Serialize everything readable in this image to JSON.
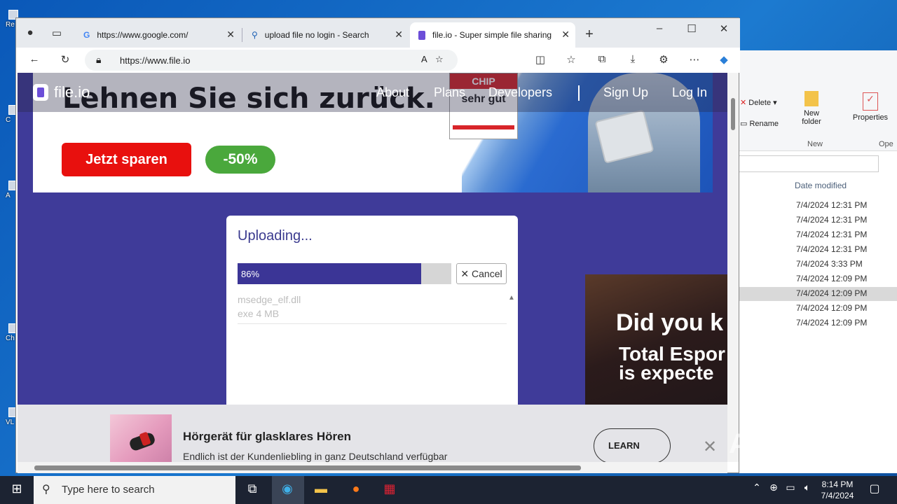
{
  "desktop": {
    "icons": [
      "Re",
      "C",
      "A",
      "Ch",
      "VL"
    ]
  },
  "explorer": {
    "ribbon": {
      "delete": "Delete",
      "rename": "Rename",
      "new_folder": "New folder",
      "new_group": "New",
      "properties": "Properties",
      "open": "Ope"
    },
    "column": "Date modified",
    "dates": [
      "7/4/2024 12:31 PM",
      "7/4/2024 12:31 PM",
      "7/4/2024 12:31 PM",
      "7/4/2024 12:31 PM",
      "7/4/2024 3:33 PM",
      "7/4/2024 12:09 PM",
      "7/4/2024 12:09 PM",
      "7/4/2024 12:09 PM",
      "7/4/2024 12:09 PM"
    ]
  },
  "browser": {
    "tabs": [
      {
        "label": "https://www.google.com/"
      },
      {
        "label": "upload file no login - Search"
      },
      {
        "label": "file.io - Super simple file sharing"
      }
    ],
    "url": "https://www.file.io"
  },
  "site": {
    "logo": "file.io",
    "nav": [
      "About",
      "Plans",
      "Developers",
      "Sign Up",
      "Log In"
    ]
  },
  "ad_top": {
    "headline": "Lehnen Sie sich zurück.",
    "button": "Jetzt sparen",
    "badge": "-50%",
    "chip_title": "sehr gut",
    "chip_brand": "CHIP"
  },
  "upload": {
    "title": "Uploading...",
    "percent": "86%",
    "progress": 0.86,
    "cancel": "Cancel",
    "file_name": "msedge_elf.dll",
    "file_size": "exe 4 MB"
  },
  "ad_right": {
    "line1": "Did you k",
    "line2": "Total Espor",
    "line3": "is expecte"
  },
  "ad_bottom": {
    "title": "Hörgerät für glasklares Hören",
    "subtitle": "Endlich ist der Kundenliebling in ganz Deutschland verfügbar",
    "cta": "LEARN"
  },
  "watermark": "ANY RUN",
  "taskbar": {
    "search_placeholder": "Type here to search",
    "time": "8:14 PM",
    "date": "7/4/2024"
  }
}
